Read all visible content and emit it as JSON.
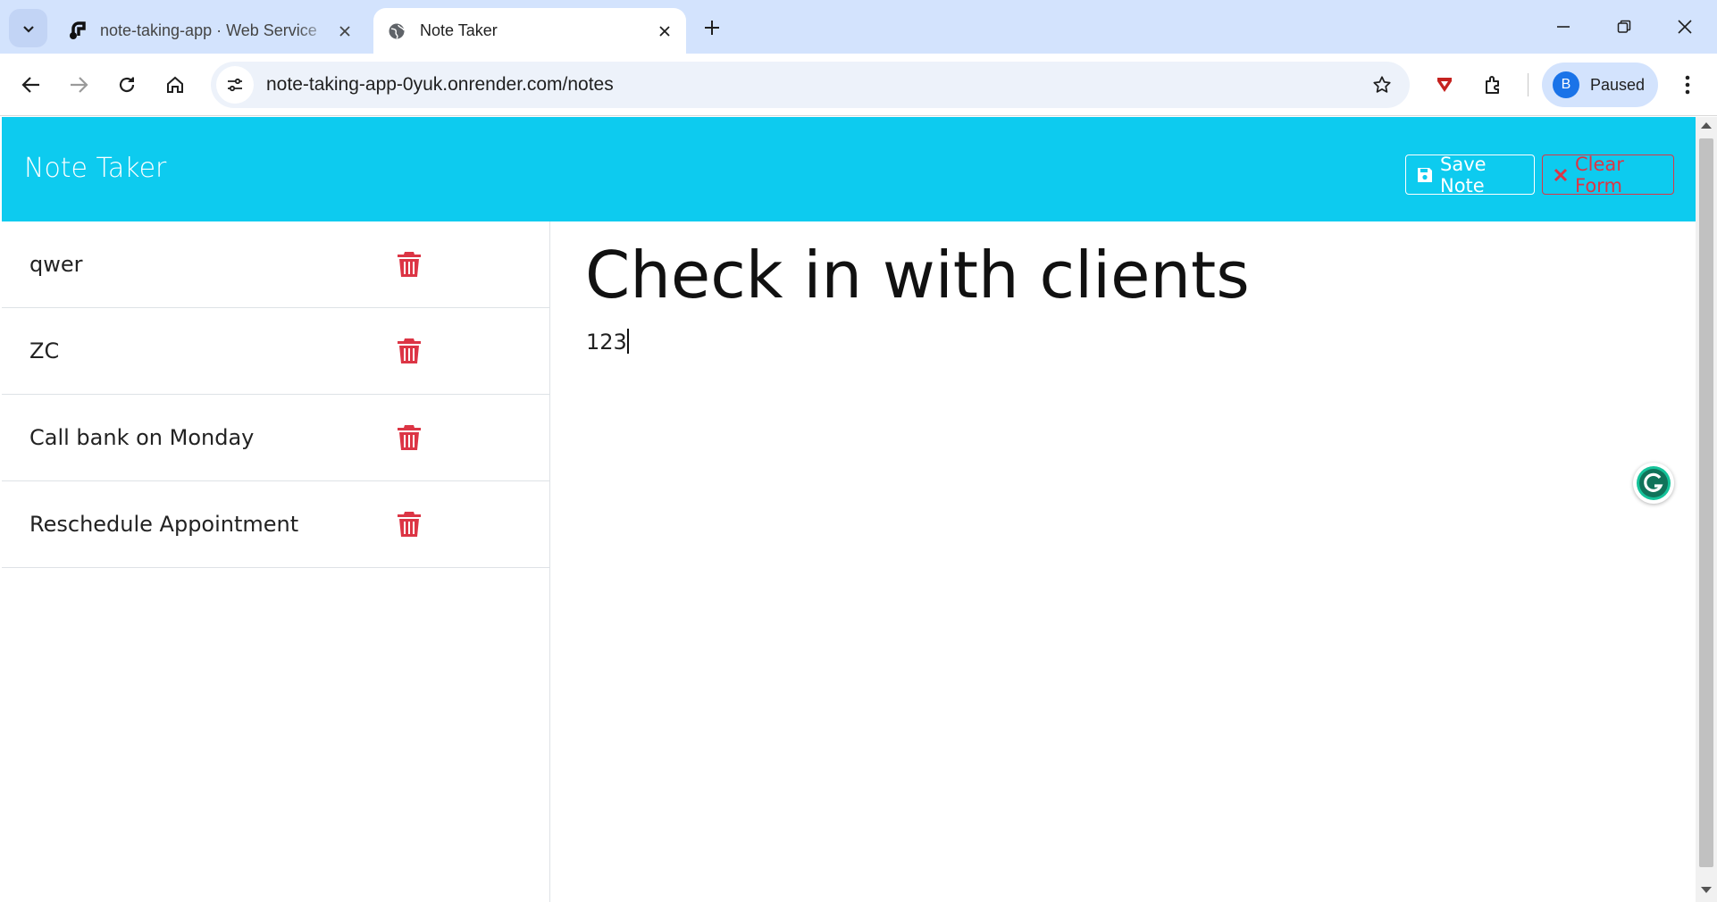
{
  "browser": {
    "tabs": [
      {
        "title": "note-taking-app · Web Service",
        "active": false,
        "favicon": "render-logo-icon"
      },
      {
        "title": "Note Taker",
        "active": true,
        "favicon": "globe-icon"
      }
    ],
    "url": "note-taking-app-0yuk.onrender.com/notes",
    "profile": {
      "initial": "B",
      "label": "Paused"
    }
  },
  "app": {
    "brand": "Note Taker",
    "buttons": {
      "save": "Save Note",
      "clear": "Clear Form"
    },
    "colors": {
      "header": "#0dcbef",
      "danger": "#dc3545"
    }
  },
  "notes": [
    {
      "title": "qwer"
    },
    {
      "title": "ZC"
    },
    {
      "title": "Call bank on Monday"
    },
    {
      "title": "Reschedule Appointment"
    }
  ],
  "active_note": {
    "title": "Check in with clients",
    "text": "123"
  }
}
